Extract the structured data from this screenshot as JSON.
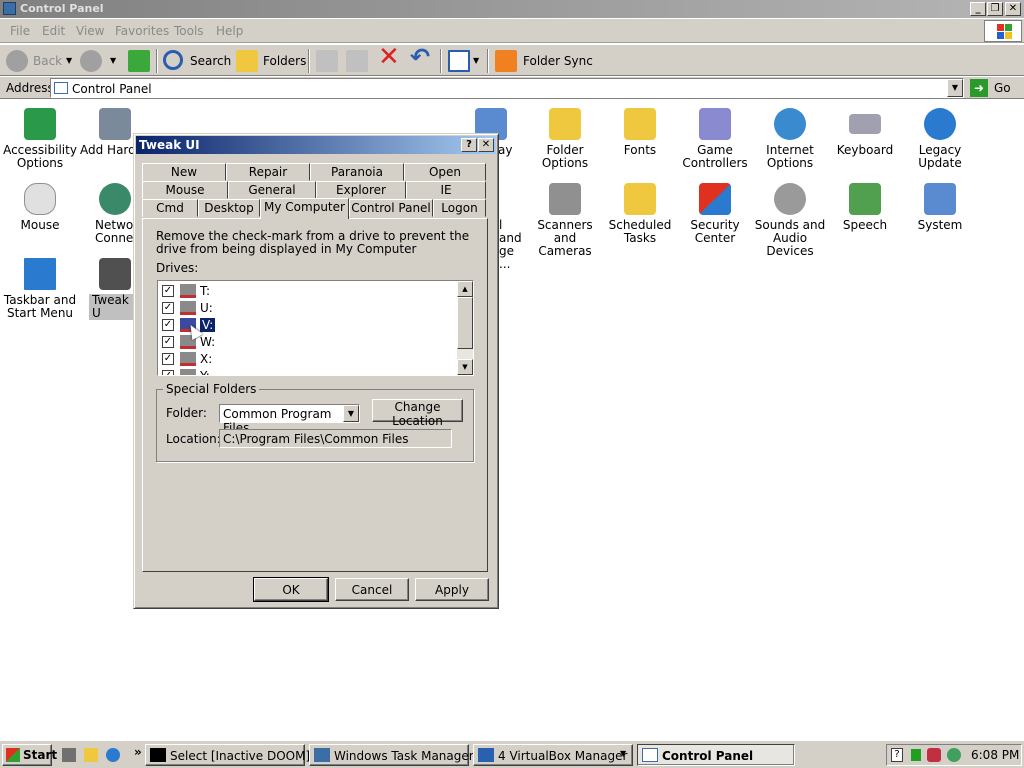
{
  "window": {
    "title": "Control Panel",
    "menu": [
      "File",
      "Edit",
      "View",
      "Favorites",
      "Tools",
      "Help"
    ]
  },
  "toolbar": {
    "back": "Back",
    "search": "Search",
    "folders": "Folders",
    "folder_sync": "Folder Sync"
  },
  "address": {
    "label": "Address",
    "value": "Control Panel",
    "go": "Go"
  },
  "icons": {
    "accessibility": "Accessibility Options",
    "add_hardware": "Add Hardw",
    "folder_options": "Folder Options",
    "fonts": "Fonts",
    "game_controllers": "Game Controllers",
    "internet_options": "Internet Options",
    "keyboard": "Keyboard",
    "legacy_update": "Legacy Update",
    "mouse": "Mouse",
    "network": "Network Connecti",
    "phone_partial": "l and ge ...",
    "scanners": "Scanners and Cameras",
    "scheduled_tasks": "Scheduled Tasks",
    "security_center": "Security Center",
    "sounds": "Sounds and Audio Devices",
    "speech": "Speech",
    "system": "System",
    "taskbar": "Taskbar and Start Menu",
    "tweakui": "Tweak U",
    "display_partial": "ay"
  },
  "dialog": {
    "title": "Tweak UI",
    "help_btn": "?",
    "close_btn": "✕",
    "tabs_row1": [
      "New",
      "Repair",
      "Paranoia",
      "Open"
    ],
    "tabs_row2": [
      "Mouse",
      "General",
      "Explorer",
      "IE"
    ],
    "tabs_row3": [
      "Cmd",
      "Desktop",
      "My Computer",
      "Control Panel",
      "Logon"
    ],
    "instruction": "Remove the check-mark from a drive to prevent the drive from being displayed in My Computer",
    "drives_label": "Drives:",
    "drives": [
      "T:",
      "U:",
      "V:",
      "W:",
      "X:",
      "Y:"
    ],
    "special_folders": "Special Folders",
    "folder_label": "Folder:",
    "folder_value": "Common Program Files",
    "change_location": "Change Location",
    "location_label": "Location:",
    "location_value": "C:\\Program Files\\Common Files",
    "ok": "OK",
    "cancel": "Cancel",
    "apply": "Apply"
  },
  "taskbar": {
    "start": "Start",
    "tasks": [
      "Select [Inactive DOOM]",
      "Windows Task Manager",
      "4 VirtualBox Manager",
      "Control Panel"
    ],
    "clock": "6:08 PM"
  }
}
